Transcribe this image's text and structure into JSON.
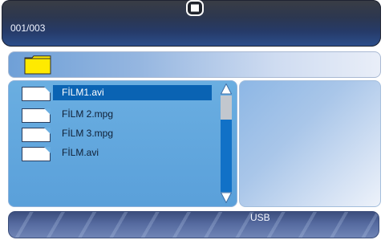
{
  "header": {
    "page_counter": "001/003",
    "stop_icon_name": "stop-icon"
  },
  "path_bar": {
    "folder_icon_name": "folder-icon"
  },
  "file_list": {
    "items": [
      {
        "label": "FİLM1.avi",
        "selected": true
      },
      {
        "label": "FİLM 2.mpg",
        "selected": false
      },
      {
        "label": "FİLM 3.mpg",
        "selected": false
      },
      {
        "label": "FİLM.avi",
        "selected": false
      }
    ],
    "scrollbar": {
      "up_icon_name": "scroll-up-icon",
      "down_icon_name": "scroll-down-icon"
    }
  },
  "footer": {
    "device_label": "USB"
  },
  "colors": {
    "header_start": "#3a3d44",
    "header_end": "#2c4f8d",
    "selection": "#0a63b3",
    "folder": "#ffea00",
    "scroll_track": "#1171c7",
    "list_panel": "#6aaee1"
  }
}
